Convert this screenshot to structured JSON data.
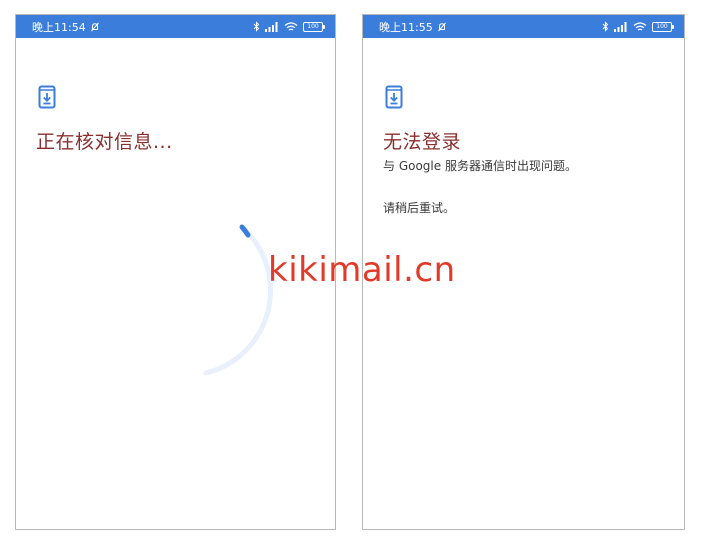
{
  "left_screen": {
    "status": {
      "time": "晚上11:54",
      "battery": "100"
    },
    "title": "正在核对信息..."
  },
  "right_screen": {
    "status": {
      "time": "晚上11:55",
      "battery": "100"
    },
    "title": "无法登录",
    "message_line1": "与 Google 服务器通信时出现问题。",
    "message_line2": "请稍后重试。"
  },
  "watermark": "kikimail.cn",
  "colors": {
    "status_bar": "#3b7ddb",
    "title": "#8a2f2f",
    "spinner": "#3b7ddb",
    "watermark": "#e23a2a"
  },
  "icons": [
    "bell-off-icon",
    "bluetooth-icon",
    "signal-icon",
    "wifi-icon",
    "battery-icon",
    "phone-download-icon",
    "loading-spinner"
  ]
}
